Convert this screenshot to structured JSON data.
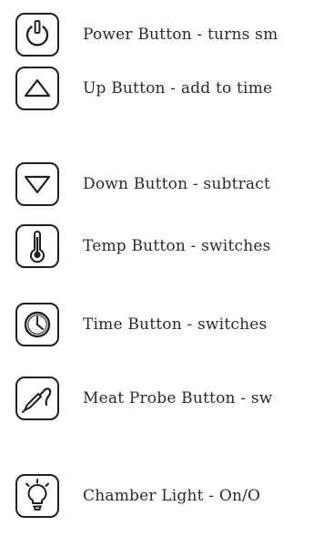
{
  "legend": {
    "items": [
      {
        "icon": "power-icon",
        "label": "Power Button - turns sm"
      },
      {
        "icon": "up-triangle-icon",
        "label": "Up Button - add to time"
      },
      {
        "icon": "down-triangle-icon",
        "label": "Down Button - subtract"
      },
      {
        "icon": "thermometer-icon",
        "label": "Temp Button - switches"
      },
      {
        "icon": "clock-icon",
        "label": "Time Button - switches"
      },
      {
        "icon": "meat-probe-icon",
        "label": "Meat Probe Button - sw"
      },
      {
        "icon": "light-bulb-icon",
        "label": "Chamber Light - On/O"
      }
    ]
  }
}
